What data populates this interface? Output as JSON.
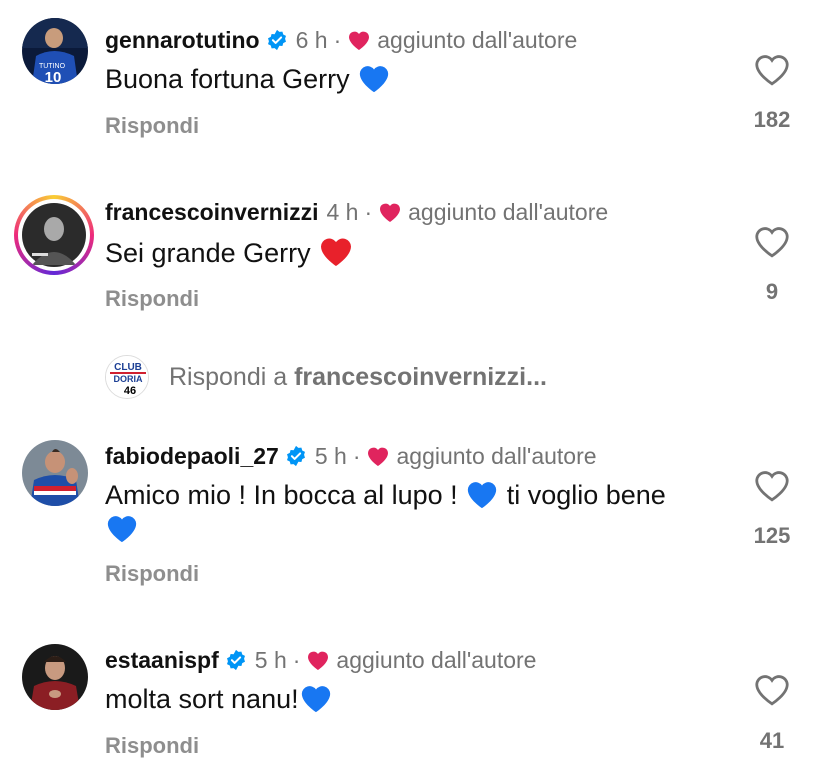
{
  "author_label": "aggiunto dall'autore",
  "reply_label": "Rispondi",
  "comments": [
    {
      "username": "gennarotutino",
      "verified": true,
      "time": "6 h",
      "text": "Buona fortuna Gerry",
      "likes": "182"
    },
    {
      "username": "francescoinvernizzi",
      "verified": false,
      "time": "4 h",
      "text": "Sei grande Gerry",
      "likes": "9"
    },
    {
      "username": "fabiodepaoli_27",
      "verified": true,
      "time": "5 h",
      "text": "Amico mio ! In bocca al lupo !",
      "text_after": "ti voglio bene",
      "likes": "125"
    },
    {
      "username": "estaanispf",
      "verified": true,
      "time": "5 h",
      "text": "molta sort nanu!",
      "likes": "41"
    }
  ],
  "reply_prompt": {
    "prefix": "Rispondi a",
    "target": "francescoinvernizzi..."
  },
  "club_logo": {
    "line1": "CLUB",
    "line2": "DORIA",
    "line3": "46"
  },
  "avatar_jersey_text": {
    "name": "TUTINO",
    "number": "10"
  },
  "colors": {
    "blue_heart": "#1877f2",
    "red_heart": "#e0245e",
    "verified": "#0095f6",
    "muted": "#737373"
  },
  "icons": {
    "like": "heart-outline-icon",
    "verified": "verified-badge-icon",
    "author_like": "red-heart-icon"
  }
}
